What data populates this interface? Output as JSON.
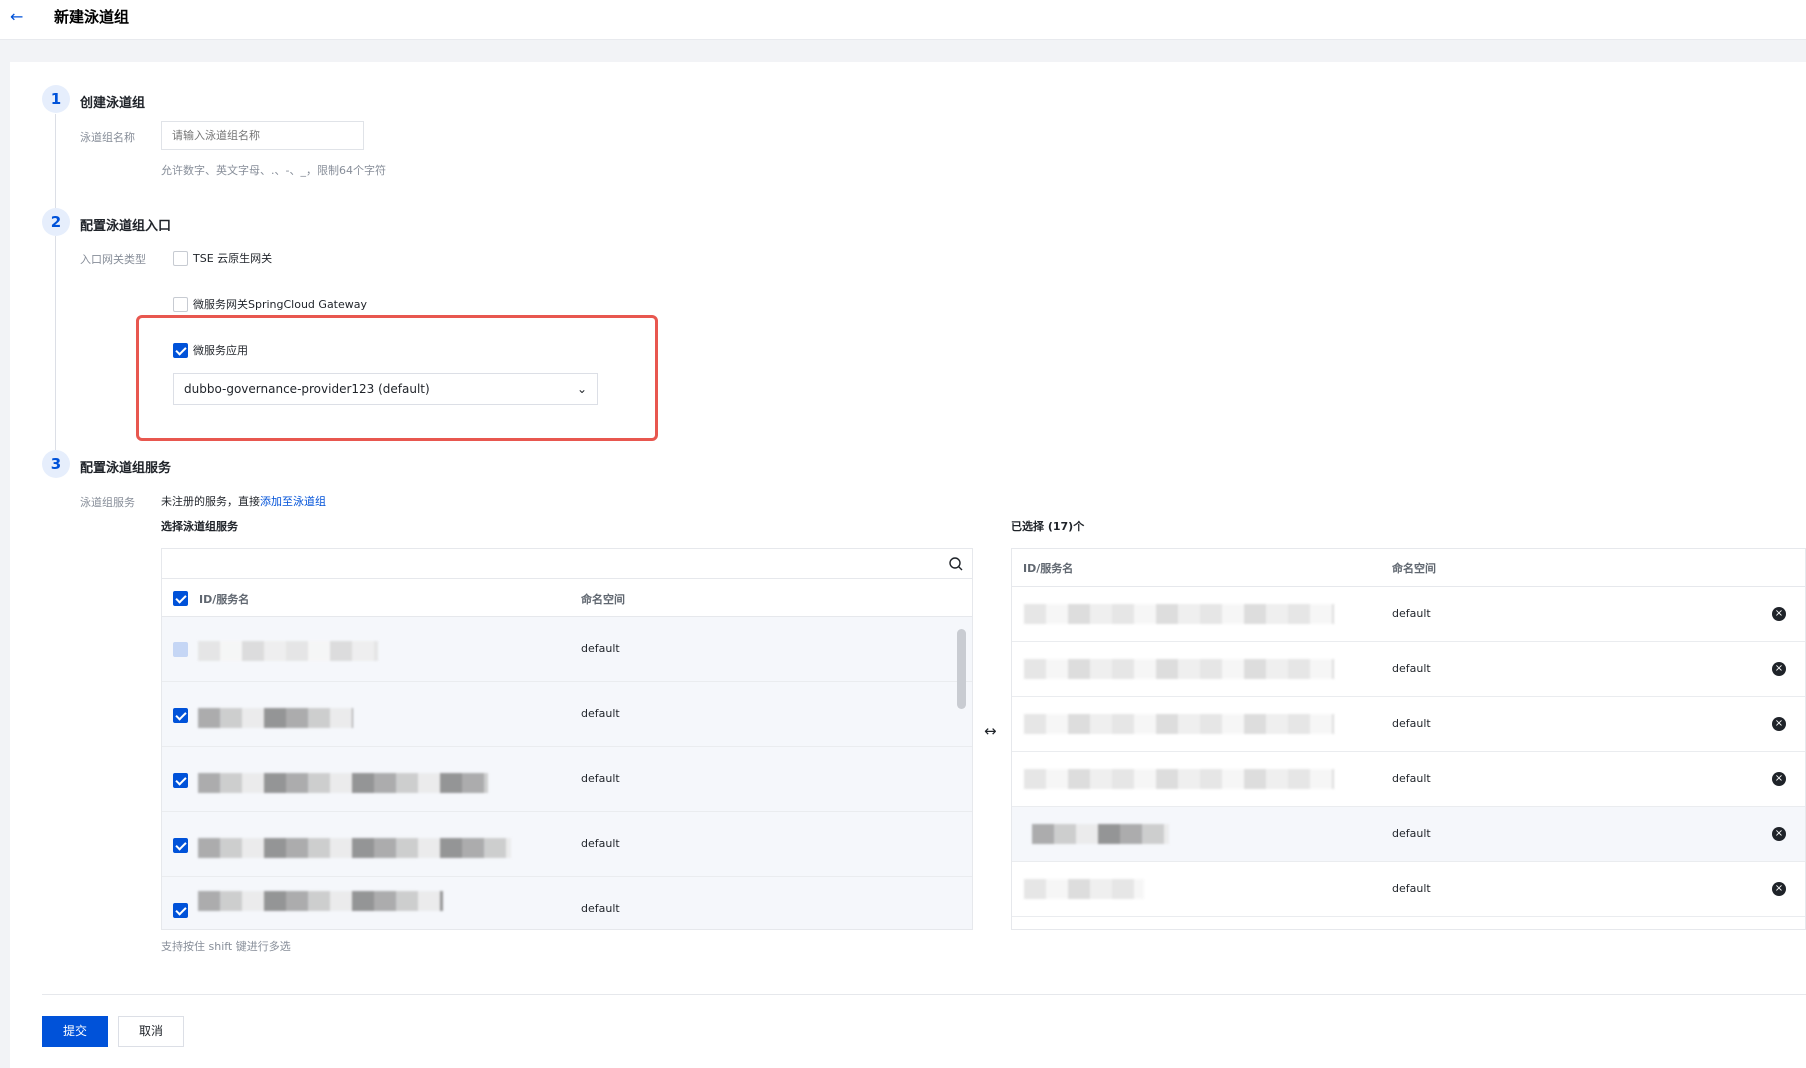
{
  "header": {
    "back_icon": "arrow-left-icon",
    "title": "新建泳道组"
  },
  "steps": [
    {
      "num": "1",
      "title": "创建泳道组"
    },
    {
      "num": "2",
      "title": "配置泳道组入口"
    },
    {
      "num": "3",
      "title": "配置泳道组服务"
    }
  ],
  "step1": {
    "name_label": "泳道组名称",
    "name_placeholder": "请输入泳道组名称",
    "name_hint": "允许数字、英文字母、.、-、_，限制64个字符"
  },
  "step2": {
    "gateway_label": "入口网关类型",
    "options": [
      {
        "label": "TSE 云原生网关",
        "checked": false
      },
      {
        "label": "微服务网关SpringCloud Gateway",
        "checked": false
      },
      {
        "label": "微服务应用",
        "checked": true
      }
    ],
    "app_select_value": "dubbo-governance-provider123 (default)",
    "accent_color": "#e8574f"
  },
  "step3": {
    "service_label": "泳道组服务",
    "unregistered_text": "未注册的服务，直接",
    "add_link": "添加至泳道组",
    "select_title": "选择泳道组服务",
    "selected_title": "已选择 (17)个",
    "col_id": "ID/服务名",
    "col_ns": "命名空间",
    "left_rows": [
      "default",
      "default",
      "default",
      "default",
      "default"
    ],
    "right_rows": [
      "default",
      "default",
      "default",
      "default",
      "default",
      "default"
    ],
    "hint": "支持按住 shift 键进行多选"
  },
  "footer": {
    "submit": "提交",
    "cancel": "取消"
  },
  "colors": {
    "primary": "#0052d9",
    "highlight": "#e8574f"
  }
}
